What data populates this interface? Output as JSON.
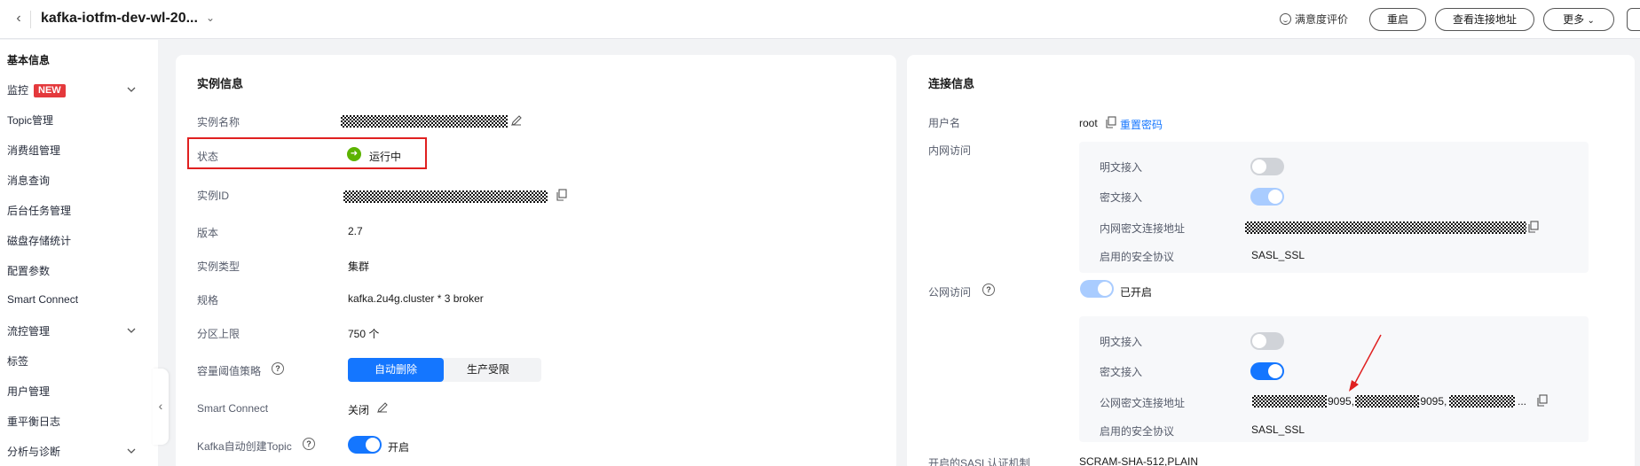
{
  "header": {
    "title": "kafka-iotfm-dev-wl-20...",
    "rate_label": "满意度评价",
    "restart_label": "重启",
    "view_addr_label": "查看连接地址",
    "more_label": "更多"
  },
  "sidebar": {
    "items": [
      {
        "label": "基本信息"
      },
      {
        "label": "监控",
        "badge": "NEW"
      },
      {
        "label": "Topic管理"
      },
      {
        "label": "消费组管理"
      },
      {
        "label": "消息查询"
      },
      {
        "label": "后台任务管理"
      },
      {
        "label": "磁盘存储统计"
      },
      {
        "label": "配置参数"
      },
      {
        "label": "Smart Connect"
      },
      {
        "label": "流控管理"
      },
      {
        "label": "标签"
      },
      {
        "label": "用户管理"
      },
      {
        "label": "重平衡日志"
      },
      {
        "label": "分析与诊断"
      }
    ]
  },
  "instance": {
    "title": "实例信息",
    "name_label": "实例名称",
    "status_label": "状态",
    "status_value": "运行中",
    "id_label": "实例ID",
    "version_label": "版本",
    "version_value": "2.7",
    "type_label": "实例类型",
    "type_value": "集群",
    "spec_label": "规格",
    "spec_value": "kafka.2u4g.cluster * 3 broker",
    "partition_label": "分区上限",
    "partition_value": "750 个",
    "policy_label": "容量阈值策略",
    "policy_options": [
      "自动删除",
      "生产受限"
    ],
    "smart_label": "Smart Connect",
    "smart_value": "关闭",
    "autotopic_label": "Kafka自动创建Topic",
    "autotopic_value": "开启"
  },
  "connection": {
    "title": "连接信息",
    "user_label": "用户名",
    "user_value": "root",
    "reset_label": "重置密码",
    "intranet_label": "内网访问",
    "intranet": {
      "plain_label": "明文接入",
      "cipher_label": "密文接入",
      "addr_label": "内网密文连接地址",
      "proto_label": "启用的安全协议",
      "proto_value": "SASL_SSL"
    },
    "public_label": "公网访问",
    "public_status": "已开启",
    "public": {
      "plain_label": "明文接入",
      "cipher_label": "密文接入",
      "addr_label": "公网密文连接地址",
      "addr_port_1": "9095,",
      "addr_port_2": ":9095,",
      "addr_ellipsis": "...",
      "proto_label": "启用的安全协议",
      "proto_value": "SASL_SSL"
    },
    "sasl_label": "开启的SASL认证机制",
    "sasl_value": "SCRAM-SHA-512,PLAIN"
  },
  "colors": {
    "accent": "#1476ff",
    "running": "#5cb300",
    "highlight": "#e02020"
  }
}
